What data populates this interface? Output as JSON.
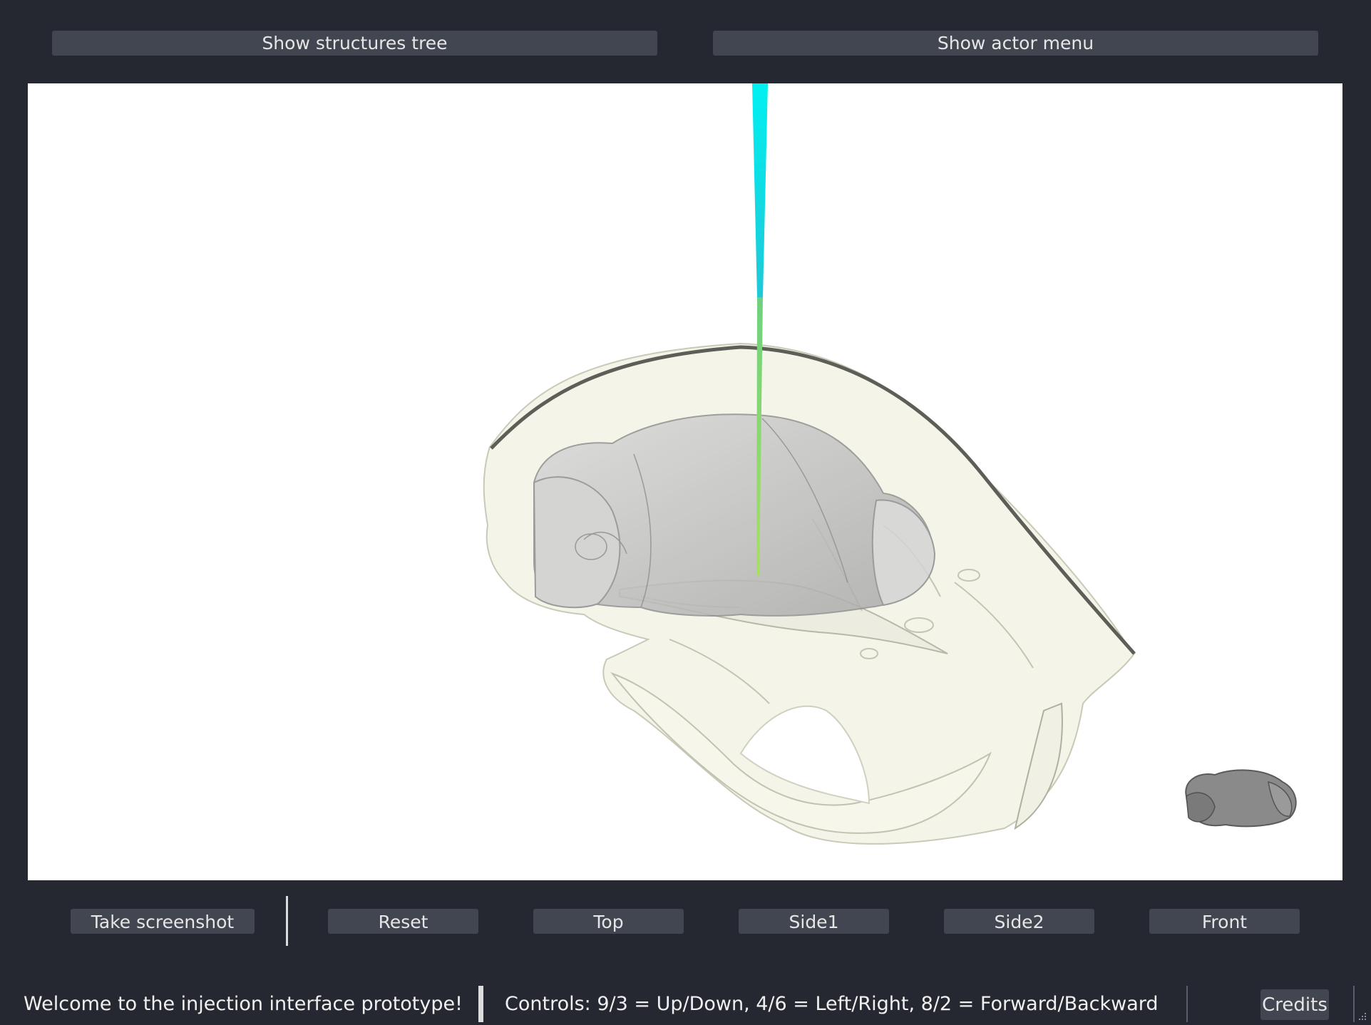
{
  "top_bar": {
    "structures_tree_label": "Show structures tree",
    "actor_menu_label": "Show actor menu"
  },
  "viewport": {
    "scene_objects": [
      "skull-mesh",
      "brain-mesh",
      "injection-needle",
      "orientation-brain-widget"
    ],
    "colors": {
      "background": "#ffffff",
      "skull": "#f3f3e6",
      "brain": "#c8c8c8",
      "needle_upper": "#00e8f0",
      "needle_lower": "#86d86c"
    }
  },
  "toolbar": {
    "screenshot_label": "Take screenshot",
    "reset_label": "Reset",
    "top_label": "Top",
    "side1_label": "Side1",
    "side2_label": "Side2",
    "front_label": "Front"
  },
  "status_bar": {
    "welcome": "Welcome to the injection interface prototype!",
    "controls": "Controls: 9/3 = Up/Down, 4/6 = Left/Right, 8/2 = Forward/Backward",
    "credits_label": "Credits"
  },
  "theme": {
    "window_bg": "#252830",
    "button_bg": "#424650",
    "text": "#e6e6e6"
  }
}
